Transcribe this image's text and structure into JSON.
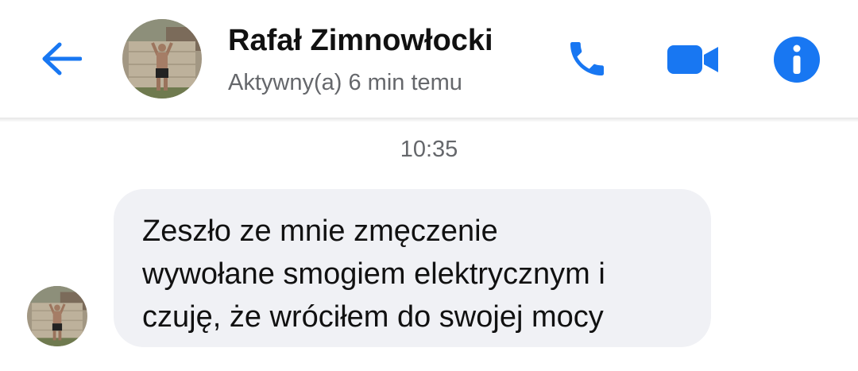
{
  "header": {
    "contact_name": "Rafał Zimnowłocki",
    "status": "Aktywny(a) 6 min temu",
    "icons": {
      "back": "arrow-left-icon",
      "call": "phone-icon",
      "video": "video-camera-icon",
      "info": "info-icon"
    },
    "accent_color": "#1877f2"
  },
  "conversation": {
    "timestamp": "10:35",
    "messages": [
      {
        "sender": "contact",
        "lines": [
          "Zeszło ze mnie zmęczenie",
          "wywołane smogiem elektrycznym i",
          "czuję, że wróciłem do swojej mocy"
        ]
      }
    ]
  }
}
